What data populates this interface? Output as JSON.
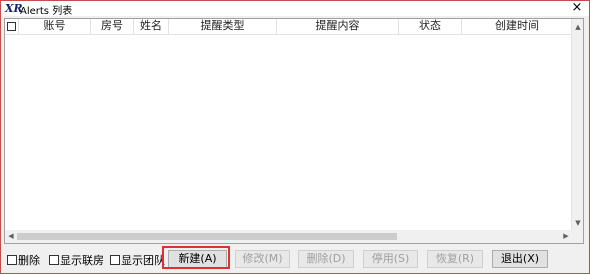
{
  "window": {
    "logo": "XR",
    "title": "Alerts 列表",
    "close_glyph": "×"
  },
  "table": {
    "columns": [
      "账号",
      "房号",
      "姓名",
      "提醒类型",
      "提醒内容",
      "状态",
      "创建时间"
    ],
    "rows": []
  },
  "scroll": {
    "up": "▲",
    "down": "▼",
    "left": "◀",
    "right": "▶"
  },
  "footer": {
    "checkboxes": [
      {
        "label": "删除",
        "checked": false
      },
      {
        "label": "显示联房",
        "checked": false
      },
      {
        "label": "显示团队",
        "checked": false
      }
    ],
    "buttons": {
      "new": "新建(A)",
      "edit": "修改(M)",
      "delete": "删除(D)",
      "disable": "停用(S)",
      "restore": "恢复(R)",
      "exit": "退出(X)"
    }
  }
}
